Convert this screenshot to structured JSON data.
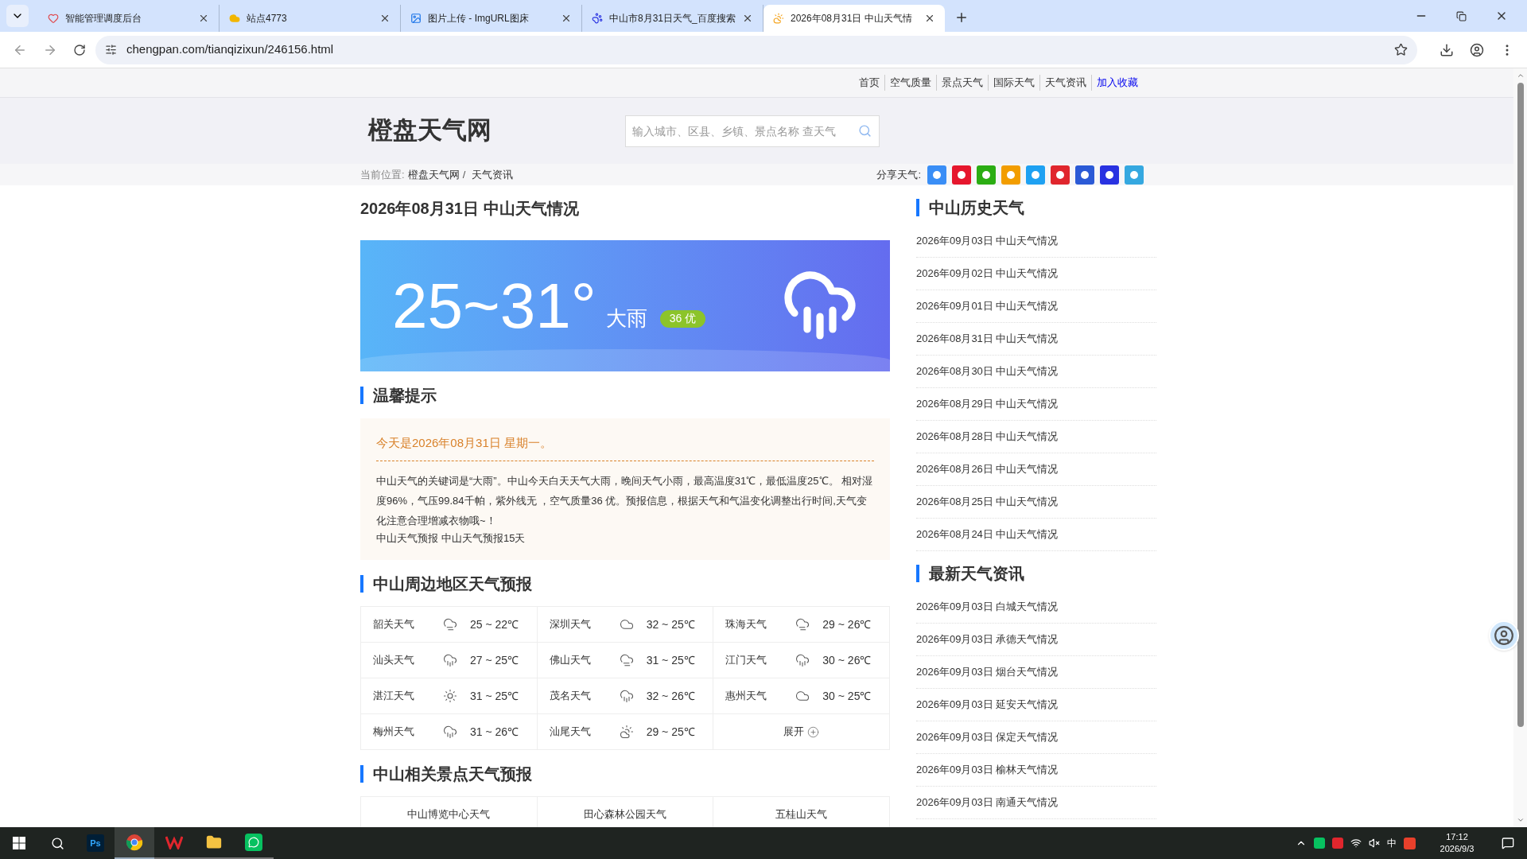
{
  "browser": {
    "tabs": [
      {
        "title": "智能管理调度后台",
        "selected": false
      },
      {
        "title": "站点4773",
        "selected": false
      },
      {
        "title": "图片上传 - ImgURL图床",
        "selected": false
      },
      {
        "title": "中山市8月31日天气_百度搜索",
        "selected": false
      },
      {
        "title": "2026年08月31日 中山天气情",
        "selected": true
      }
    ],
    "url": "chengpan.com/tianqizixun/246156.html"
  },
  "site_nav": [
    {
      "label": "首页",
      "kind": "link"
    },
    {
      "label": "空气质量",
      "kind": "link"
    },
    {
      "label": "景点天气",
      "kind": "link"
    },
    {
      "label": "国际天气",
      "kind": "link"
    },
    {
      "label": "天气资讯",
      "kind": "link"
    },
    {
      "label": "加入收藏",
      "kind": "action"
    }
  ],
  "logo": "橙盘天气网",
  "search": {
    "placeholder": "输入城市、区县、乡镇、景点名称 查天气"
  },
  "breadcrumb": {
    "label": "当前位置:",
    "items": [
      "橙盘天气网",
      "天气资讯"
    ],
    "separator": "/"
  },
  "share": {
    "label": "分享天气:"
  },
  "article": {
    "title": "2026年08月31日 中山天气情况",
    "banner": {
      "temperature": "25~31°",
      "condition": "大雨",
      "aqi": "36 优"
    },
    "tips": {
      "heading": "温馨提示",
      "date_line": "今天是2026年08月31日 星期一。",
      "body": "中山天气的关键词是“大雨”。中山今天白天天气大雨，晚间天气小雨，最高温度31℃，最低温度25℃。 相对湿度96%，气压99.84千帕，紫外线无 ，空气质量36 优。预报信息，根据天气和气温变化调整出行时间,天气变化注意合理增减衣物哦~！",
      "links": [
        "中山天气预报",
        "中山天气预报15天"
      ]
    },
    "nearby": {
      "heading": "中山周边地区天气预报",
      "cells": [
        {
          "city": "韶关天气",
          "kind": "fog",
          "temp": "25 ~ 22℃"
        },
        {
          "city": "深圳天气",
          "kind": "cloud",
          "temp": "32 ~ 25℃"
        },
        {
          "city": "珠海天气",
          "kind": "fog",
          "temp": "29 ~ 26℃"
        },
        {
          "city": "汕头天气",
          "kind": "rain",
          "temp": "27 ~ 25℃"
        },
        {
          "city": "佛山天气",
          "kind": "fog",
          "temp": "31 ~ 25℃"
        },
        {
          "city": "江门天气",
          "kind": "rain",
          "temp": "30 ~ 26℃"
        },
        {
          "city": "湛江天气",
          "kind": "sun",
          "temp": "31 ~ 25℃"
        },
        {
          "city": "茂名天气",
          "kind": "rain",
          "temp": "32 ~ 26℃"
        },
        {
          "city": "惠州天气",
          "kind": "cloud",
          "temp": "30 ~ 25℃"
        },
        {
          "city": "梅州天气",
          "kind": "rain",
          "temp": "31 ~ 26℃"
        },
        {
          "city": "汕尾天气",
          "kind": "sun-cloud",
          "temp": "29 ~ 25℃"
        }
      ],
      "expand": "展开"
    },
    "spots": {
      "heading": "中山相关景点天气预报",
      "items": [
        "中山博览中心天气",
        "田心森林公园天气",
        "五桂山天气"
      ]
    }
  },
  "sidebar": {
    "history": {
      "heading": "中山历史天气",
      "items": [
        "2026年09月03日 中山天气情况",
        "2026年09月02日 中山天气情况",
        "2026年09月01日 中山天气情况",
        "2026年08月31日 中山天气情况",
        "2026年08月30日 中山天气情况",
        "2026年08月29日 中山天气情况",
        "2026年08月28日 中山天气情况",
        "2026年08月26日 中山天气情况",
        "2026年08月25日 中山天气情况",
        "2026年08月24日 中山天气情况"
      ]
    },
    "news": {
      "heading": "最新天气资讯",
      "items": [
        "2026年09月03日 白城天气情况",
        "2026年09月03日 承德天气情况",
        "2026年09月03日 烟台天气情况",
        "2026年09月03日 延安天气情况",
        "2026年09月03日 保定天气情况",
        "2026年09月03日 榆林天气情况",
        "2026年09月03日 南通天气情况"
      ]
    }
  },
  "taskbar": {
    "ps_label": "Ps",
    "ime": "中",
    "time": "17:12",
    "date": "2026/9/3"
  }
}
